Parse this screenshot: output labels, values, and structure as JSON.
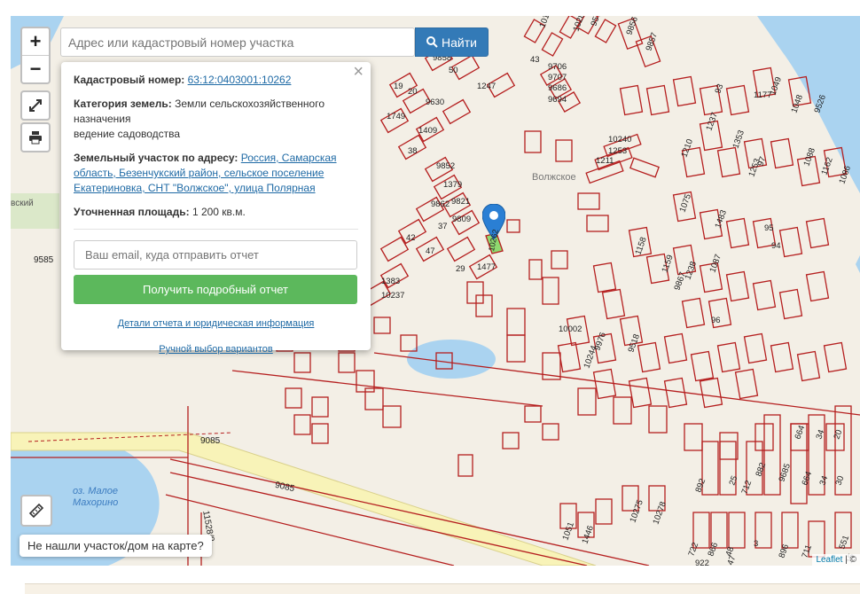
{
  "search": {
    "placeholder": "Адрес или кадастровый номер участка",
    "button_label": "Найти"
  },
  "zoom": {
    "in_label": "+",
    "out_label": "−"
  },
  "popup": {
    "cadastral_label": "Кадастровый номер:",
    "cadastral_value": "63:12:0403001:10262",
    "category_label": "Категория земель:",
    "category_value": "Земли сельскохозяйственного назначения",
    "category_use": "ведение садоводства",
    "address_label": "Земельный участок по адресу:",
    "address_value": "Россия, Самарская область, Безенчукский район, сельское поселение Екатериновка, СНТ \"Волжское\", улица Полярная",
    "area_label": "Уточненная площадь:",
    "area_value": "1 200 кв.м.",
    "email_placeholder": "Ваш email, куда отправить отчет",
    "report_button": "Получить подробный отчет",
    "details_link": "Детали отчета и юридическая информация",
    "manual_link": "Ручной выбор вариантов",
    "close": "×"
  },
  "not_found_button": "Не нашли участок/дом на карте?",
  "attribution": {
    "leaflet": "Leaflet",
    "rest": " | ©"
  },
  "map_labels": {
    "volzhskoe": "Волжское",
    "lake": "оз. Малое Махорино",
    "road_1": "9085",
    "road_2": "9085",
    "road_3": "11528/8",
    "left_num": "9585",
    "left_text": "вский",
    "marker_plot": "10262"
  },
  "parcel_numbers": [
    "1010",
    "1028",
    "9577",
    "9856",
    "9857",
    "43",
    "9706",
    "9707",
    "9686",
    "9694",
    "1247",
    "50",
    "9858",
    "19",
    "20",
    "1749",
    "9630",
    "1409",
    "38",
    "9852",
    "1379",
    "9821",
    "9809",
    "9862",
    "37",
    "42",
    "47",
    "29",
    "1477",
    "1383",
    "10237",
    "10240",
    "1253",
    "1211",
    "1210",
    "93",
    "1177",
    "1049",
    "1048",
    "9526",
    "1237",
    "1353",
    "97",
    "1253",
    "1088",
    "1162",
    "1086",
    "1075",
    "1483",
    "95",
    "94",
    "1158",
    "1159",
    "1238",
    "1087",
    "9867",
    "96",
    "10002",
    "9976",
    "9518",
    "10244",
    "664",
    "34",
    "20",
    "892",
    "25",
    "882",
    "9685",
    "712",
    "664",
    "34",
    "30",
    "1051",
    "1446",
    "10275",
    "10278",
    "722",
    "866",
    "48",
    "3",
    "896",
    "711",
    "551",
    "15",
    "922",
    "47"
  ],
  "colors": {
    "parcel_border": "#b51f1f",
    "map_bg": "#f3efe6",
    "water": "#aad3f0",
    "road": "#f8f3b8",
    "marker": "#2a7fd4",
    "selected_parcel": "#8fd96f",
    "search_button": "#337ab7",
    "report_button": "#5cb85c"
  },
  "icons": [
    "fullscreen-icon",
    "print-icon",
    "ruler-icon",
    "search-icon",
    "marker-icon"
  ]
}
